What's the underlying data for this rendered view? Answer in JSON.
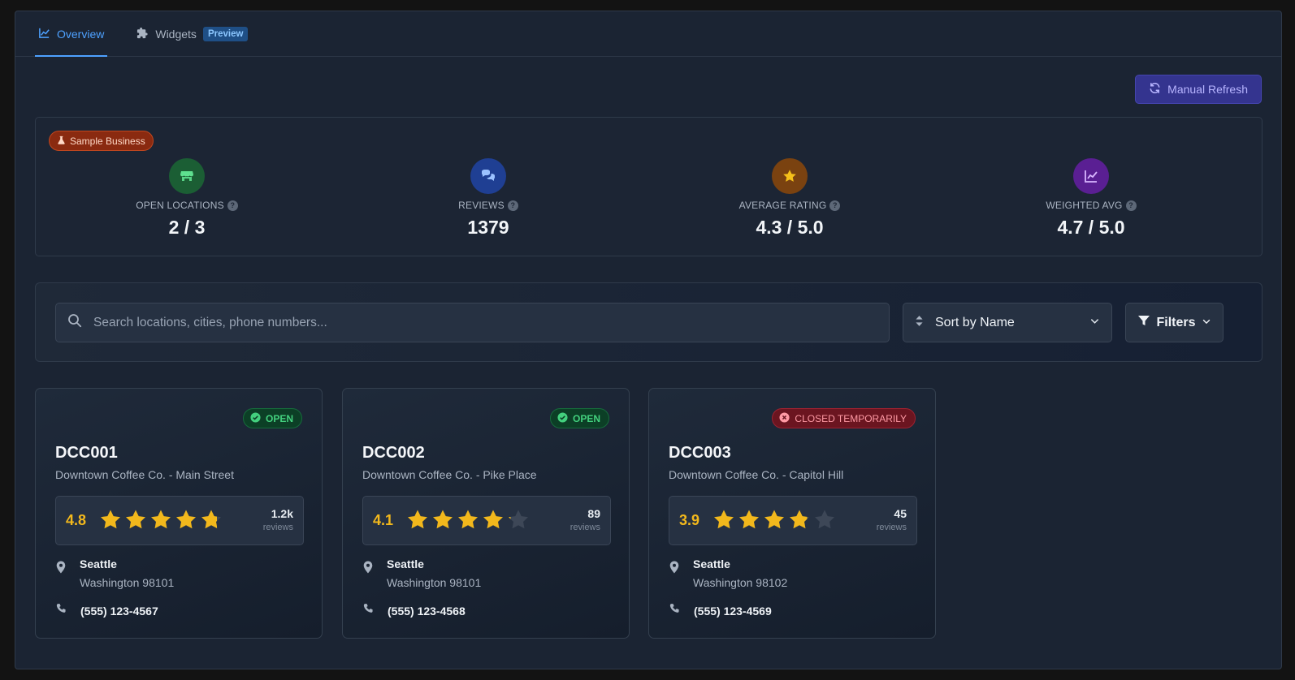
{
  "tabs": [
    {
      "label": "Overview",
      "icon": "line-chart-icon",
      "active": true
    },
    {
      "label": "Widgets",
      "icon": "puzzle-icon",
      "badge": "Preview",
      "active": false
    }
  ],
  "toolbar": {
    "refresh_label": "Manual Refresh"
  },
  "summary": {
    "badge": "Sample Business",
    "stats": [
      {
        "label": "OPEN LOCATIONS",
        "value": "2 / 3",
        "icon": "store-icon",
        "color": "#1b5e34",
        "icon_color": "#5ee08f"
      },
      {
        "label": "REVIEWS",
        "value": "1379",
        "icon": "chat-bubbles-icon",
        "color": "#1f3f93",
        "icon_color": "#9cc2ff"
      },
      {
        "label": "AVERAGE RATING",
        "value": "4.3 / 5.0",
        "icon": "star-icon",
        "color": "#7a4210",
        "icon_color": "#f5c01a"
      },
      {
        "label": "WEIGHTED AVG",
        "value": "4.7 / 5.0",
        "icon": "trend-chart-icon",
        "color": "#5a1f93",
        "icon_color": "#d8b6ff"
      }
    ]
  },
  "search": {
    "placeholder": "Search locations, cities, phone numbers..."
  },
  "sort": {
    "selected": "Sort by Name"
  },
  "filters": {
    "label": "Filters"
  },
  "locations": [
    {
      "code": "DCC001",
      "name": "Downtown Coffee Co. - Main Street",
      "status": "OPEN",
      "status_type": "open",
      "rating": 4.8,
      "rating_label": "4.8",
      "review_count": "1.2k",
      "reviews_label": "reviews",
      "city": "Seattle",
      "state_zip": "Washington 98101",
      "phone": "(555) 123-4567"
    },
    {
      "code": "DCC002",
      "name": "Downtown Coffee Co. - Pike Place",
      "status": "OPEN",
      "status_type": "open",
      "rating": 4.1,
      "rating_label": "4.1",
      "review_count": "89",
      "reviews_label": "reviews",
      "city": "Seattle",
      "state_zip": "Washington 98101",
      "phone": "(555) 123-4568"
    },
    {
      "code": "DCC003",
      "name": "Downtown Coffee Co. - Capitol Hill",
      "status": "CLOSED TEMPORARILY",
      "status_type": "closed",
      "rating": 3.9,
      "rating_label": "3.9",
      "review_count": "45",
      "reviews_label": "reviews",
      "city": "Seattle",
      "state_zip": "Washington 98102",
      "phone": "(555) 123-4569"
    }
  ],
  "colors": {
    "accent": "#4ea1ff",
    "star": "#f2b81c",
    "star_empty": "#3d4757"
  }
}
